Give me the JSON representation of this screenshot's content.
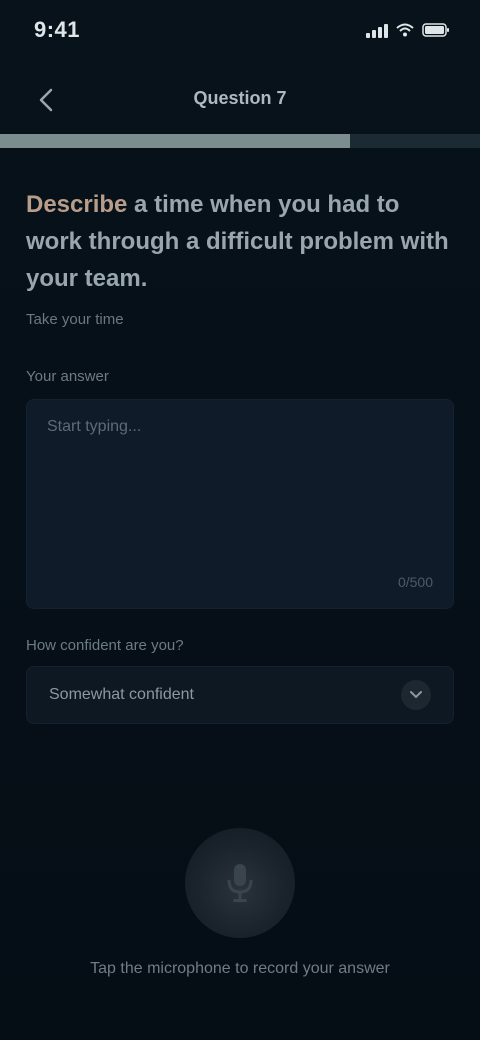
{
  "status_bar": {
    "time": "9:41"
  },
  "nav": {
    "title": "Question 7",
    "back_icon": "chevron-left-icon"
  },
  "progress": {
    "fraction": 0.73
  },
  "question": {
    "highlight": "Describe",
    "text": " a time when you had to work through a difficult problem with your team.",
    "sub": "Take your time"
  },
  "answer": {
    "label": "Your answer",
    "placeholder": "Start typing...",
    "char_count": "0/500"
  },
  "confidence": {
    "label": "How confident are you?",
    "value": "Somewhat confident",
    "chevron_icon": "chevron-down-icon"
  },
  "mic": {
    "icon": "microphone-icon",
    "hint": "Tap the microphone to record your answer"
  },
  "colors": {
    "background": "#061019",
    "progress_fill": "#7b8d8e",
    "highlight": "#b99d8a"
  }
}
